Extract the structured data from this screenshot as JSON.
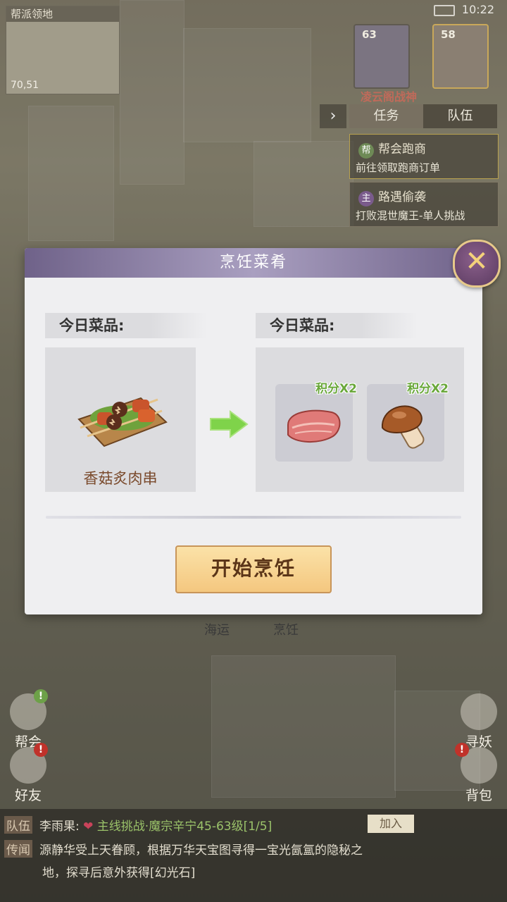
{
  "status": {
    "time": "10:22"
  },
  "minimap": {
    "name": "帮派领地",
    "coord": "70,51"
  },
  "party": [
    {
      "level": "63"
    },
    {
      "level": "58"
    }
  ],
  "character_name": "凌云阁战神",
  "quest_panel": {
    "tabs": [
      "任务",
      "队伍"
    ],
    "items": [
      {
        "tag": "帮",
        "title": "帮会跑商",
        "desc": "前往领取跑商订单"
      },
      {
        "tag": "主",
        "title": "路遇偷袭",
        "desc": "打败混世魔王-单人挑战"
      }
    ]
  },
  "side_buttons": {
    "guild": "帮会",
    "friends": "好友",
    "seek": "寻妖",
    "bag": "背包"
  },
  "bottom_labels": {
    "shipping": "海运",
    "cooking": "烹饪"
  },
  "chat": {
    "line1": {
      "channel": "队伍",
      "user": "李雨果:",
      "highlight": "主线挑战·魔宗辛宁45-63级[1/5]",
      "join": "加入"
    },
    "line2": {
      "channel": "传闻",
      "text": "源静华受上天眷顾，根据万华天宝图寻得一宝光氤氲的隐秘之",
      "text2": "地，探寻后意外获得[幻光石]"
    }
  },
  "dialog": {
    "title": "烹饪菜肴",
    "left_label": "今日菜品:",
    "right_label": "今日菜品:",
    "dish_name": "香菇炙肉串",
    "ingredients": [
      {
        "name": "meat",
        "bonus": "积分X2"
      },
      {
        "name": "mushroom",
        "bonus": "积分X2"
      }
    ],
    "start_button": "开始烹饪"
  },
  "colors": {
    "dialog_header": "#8a7ea6",
    "button": "#f4c77f",
    "bonus_text": "#6aa83b",
    "dish_name": "#7a4a2c"
  }
}
